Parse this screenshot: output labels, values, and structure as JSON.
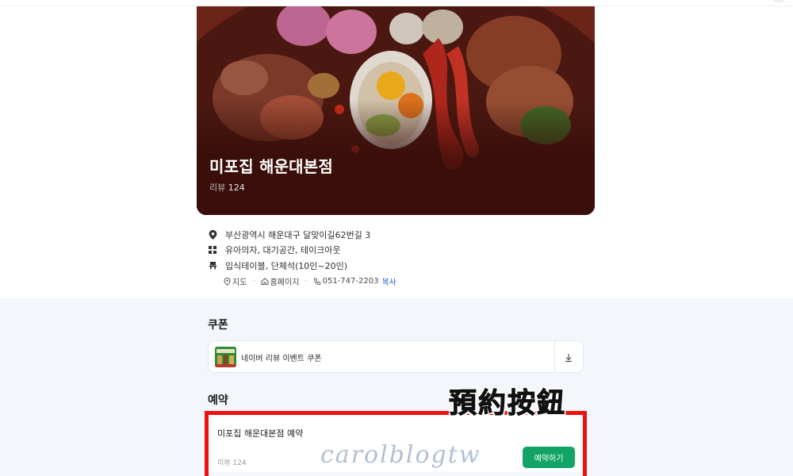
{
  "store": {
    "name": "미포집 해운대본점",
    "review_label": "리뷰",
    "review_count": "124"
  },
  "info": {
    "address": "부산광역시 해운대구 달맞이길62번길 3",
    "facilities": "유아의자, 대기공간, 테이크아웃",
    "seating": "입식테이블, 단체석(10인~20인)",
    "links": {
      "map": "지도",
      "homepage": "홈페이지",
      "phone": "051-747-2203",
      "copy": "복사"
    }
  },
  "coupon": {
    "section_title": "쿠폰",
    "label": "네이버 리뷰 이벤트 쿠폰"
  },
  "reservation": {
    "section_title": "예약",
    "title": "미포집 해운대본점 예약",
    "review": "리뷰 124",
    "button": "예약하기"
  },
  "annotation": {
    "text": "預約按鈕",
    "highlight_color": "#ee1111"
  },
  "watermark": "carolblogtw",
  "colors": {
    "accent_green": "#12a466",
    "link_blue": "#1f67d8"
  }
}
